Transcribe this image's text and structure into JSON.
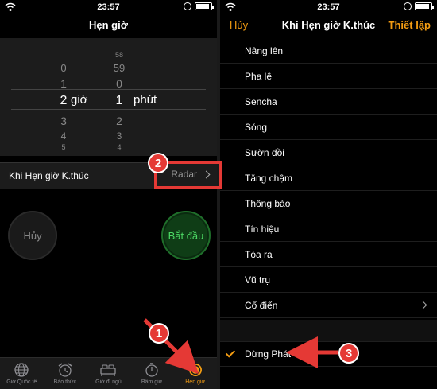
{
  "status": {
    "time": "23:57"
  },
  "left": {
    "title": "Hẹn giờ",
    "picker": {
      "hours_above": [
        "0",
        "1"
      ],
      "hours_selected": "2",
      "hours_below": [
        "3",
        "4",
        "5"
      ],
      "hours_unit": "giờ",
      "minutes_above": [
        "58",
        "59",
        "0"
      ],
      "minutes_selected": "1",
      "minutes_below": [
        "2",
        "3",
        "4"
      ],
      "minutes_unit": "phút"
    },
    "timer_end": {
      "label": "Khi Hẹn giờ K.thúc",
      "value": "Radar"
    },
    "cancel_label": "Hủy",
    "start_label": "Bắt đầu",
    "tabs": [
      {
        "label": "Giờ Quốc tế",
        "icon": "globe-icon"
      },
      {
        "label": "Báo thức",
        "icon": "alarm-clock-icon"
      },
      {
        "label": "Giờ đi ngủ",
        "icon": "bed-icon"
      },
      {
        "label": "Bấm giờ",
        "icon": "stopwatch-icon"
      },
      {
        "label": "Hẹn giờ",
        "icon": "timer-icon",
        "active": true
      }
    ]
  },
  "right": {
    "cancel": "Hủy",
    "title": "Khi Hẹn giờ K.thúc",
    "set": "Thiết lập",
    "sounds": [
      "Nâng lên",
      "Pha lê",
      "Sencha",
      "Sóng",
      "Sườn đồi",
      "Tăng chậm",
      "Thông báo",
      "Tín hiệu",
      "Tỏa ra",
      "Vũ trụ",
      "Cổ điển"
    ],
    "stop_playing": "Dừng Phát"
  },
  "annotations": {
    "step1": "1",
    "step2": "2",
    "step3": "3"
  },
  "colors": {
    "accent": "#f39c12",
    "annotation": "#e53935",
    "start_green": "#4cd964"
  }
}
